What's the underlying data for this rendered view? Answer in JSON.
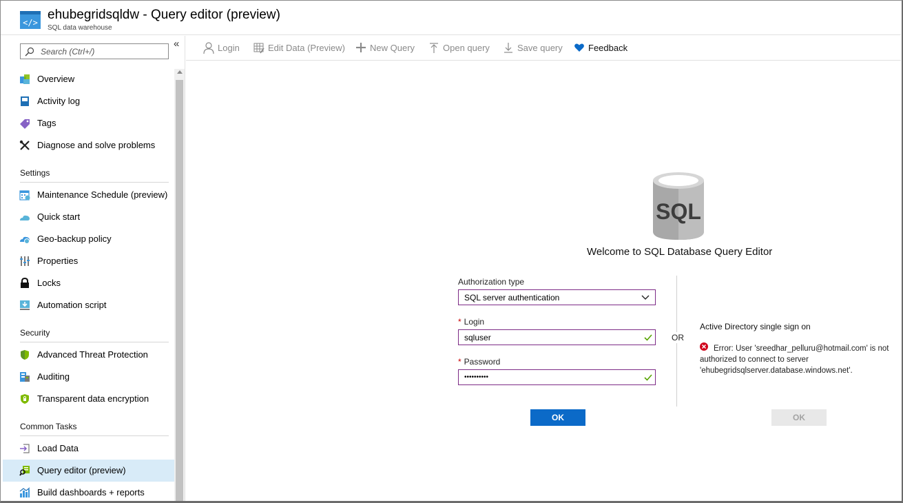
{
  "header": {
    "title": "ehubegridsqldw - Query editor (preview)",
    "subtitle": "SQL data warehouse",
    "icon": "sql-dw-resource-icon"
  },
  "sidebar": {
    "search_placeholder": "Search (Ctrl+/)",
    "collapse_label": "«",
    "items_top": [
      {
        "label": "Overview",
        "icon": "overview-icon"
      },
      {
        "label": "Activity log",
        "icon": "activity-log-icon"
      },
      {
        "label": "Tags",
        "icon": "tag-icon"
      },
      {
        "label": "Diagnose and solve problems",
        "icon": "wrench-icon"
      }
    ],
    "settings_header": "Settings",
    "items_settings": [
      {
        "label": "Maintenance Schedule (preview)",
        "icon": "calendar-icon"
      },
      {
        "label": "Quick start",
        "icon": "cloud-icon"
      },
      {
        "label": "Geo-backup policy",
        "icon": "geo-backup-icon"
      },
      {
        "label": "Properties",
        "icon": "properties-icon"
      },
      {
        "label": "Locks",
        "icon": "lock-icon"
      },
      {
        "label": "Automation script",
        "icon": "download-icon"
      }
    ],
    "security_header": "Security",
    "items_security": [
      {
        "label": "Advanced Threat Protection",
        "icon": "shield-icon"
      },
      {
        "label": "Auditing",
        "icon": "auditing-icon"
      },
      {
        "label": "Transparent data encryption",
        "icon": "encryption-shield-icon"
      }
    ],
    "tasks_header": "Common Tasks",
    "items_tasks": [
      {
        "label": "Load Data",
        "icon": "load-data-icon"
      },
      {
        "label": "Query editor (preview)",
        "icon": "query-editor-icon",
        "active": true
      },
      {
        "label": "Build dashboards + reports",
        "icon": "chart-icon"
      }
    ]
  },
  "toolbar": {
    "login": "Login",
    "edit_data": "Edit Data (Preview)",
    "new_query": "New Query",
    "open_query": "Open query",
    "save_query": "Save query",
    "feedback": "Feedback"
  },
  "main": {
    "db_icon_text": "SQL",
    "welcome": "Welcome to SQL Database Query Editor",
    "auth_type_label": "Authorization type",
    "auth_type_value": "SQL server authentication",
    "login_label": "Login",
    "login_value": "sqluser",
    "password_label": "Password",
    "password_value": "••••••••••",
    "required_mark": "*",
    "or_label": "OR",
    "ad_title": "Active Directory single sign on",
    "error_text": "Error: User 'sreedhar_pelluru@hotmail.com' is not authorized to connect to server 'ehubegridsqlserver.database.windows.net'.",
    "ok_label": "OK",
    "ok_ad_label": "OK"
  },
  "colors": {
    "accent": "#0b6ac8",
    "field_border": "#7c2a86",
    "active_nav": "#d8ebf8",
    "error": "#d0021b",
    "valid": "#57a300"
  }
}
